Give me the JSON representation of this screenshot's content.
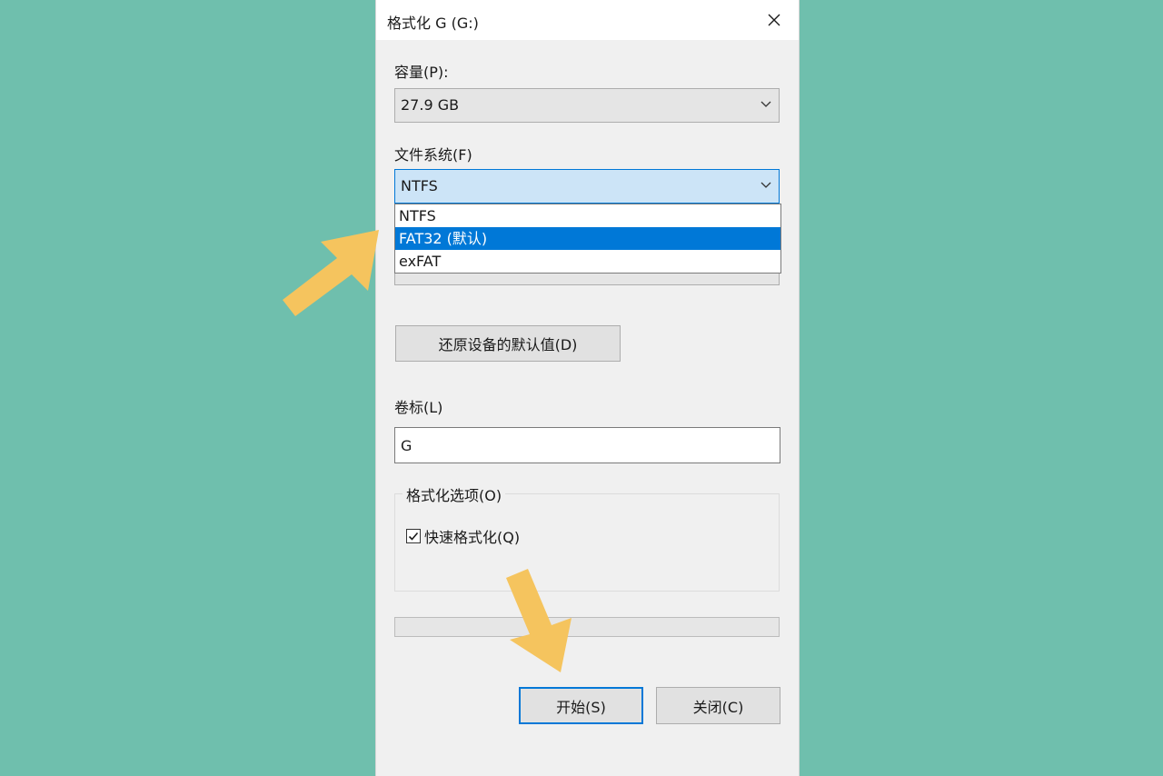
{
  "dialog": {
    "title": "格式化 G (G:)",
    "close_icon": "close-icon"
  },
  "capacity": {
    "label": "容量(P):",
    "value": "27.9 GB"
  },
  "filesystem": {
    "label": "文件系统(F)",
    "value": "NTFS",
    "options": [
      "NTFS",
      "FAT32 (默认)",
      "exFAT"
    ],
    "highlighted_option": "FAT32 (默认)"
  },
  "restore_defaults_button": "还原设备的默认值(D)",
  "volume_label": {
    "label": "卷标(L)",
    "value": "G"
  },
  "format_options": {
    "legend": "格式化选项(O)",
    "quick_format_label": "快速格式化(Q)",
    "quick_format_checked": true
  },
  "progress": {
    "value": 0
  },
  "buttons": {
    "start": "开始(S)",
    "close": "关闭(C)"
  },
  "annotations": {
    "arrow_color": "#f5c45e",
    "arrows": [
      "pointing-arrow-icon",
      "pointing-arrow-icon"
    ]
  },
  "colors": {
    "background": "#6fbfad",
    "selection": "#0078d7",
    "focus_fill": "#cce4f7"
  }
}
